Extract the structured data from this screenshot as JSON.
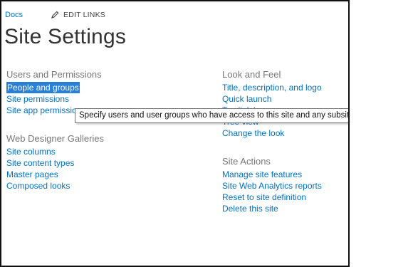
{
  "topbar": {
    "breadcrumb": "Docs",
    "edit_links": "EDIT LINKS",
    "edit_icon": "pencil-icon"
  },
  "page_title": "Site Settings",
  "sections": {
    "users_permissions": {
      "heading": "Users and Permissions",
      "items": [
        "People and groups",
        "Site permissions",
        "Site app permissions"
      ]
    },
    "web_designer_galleries": {
      "heading": "Web Designer Galleries",
      "items": [
        "Site columns",
        "Site content types",
        "Master pages",
        "Composed looks"
      ]
    },
    "look_and_feel": {
      "heading": "Look and Feel",
      "items": [
        "Title, description, and logo",
        "Quick launch",
        "Top link bar",
        "Tree view",
        "Change the look"
      ]
    },
    "site_actions": {
      "heading": "Site Actions",
      "items": [
        "Manage site features",
        "Site Web Analytics reports",
        "Reset to site definition",
        "Delete this site"
      ]
    }
  },
  "tooltip": "Specify users and user groups who have access to this site and any subsites",
  "colors": {
    "link": "#0072c6",
    "heading": "#777777",
    "selection": "#2a7fd6"
  }
}
